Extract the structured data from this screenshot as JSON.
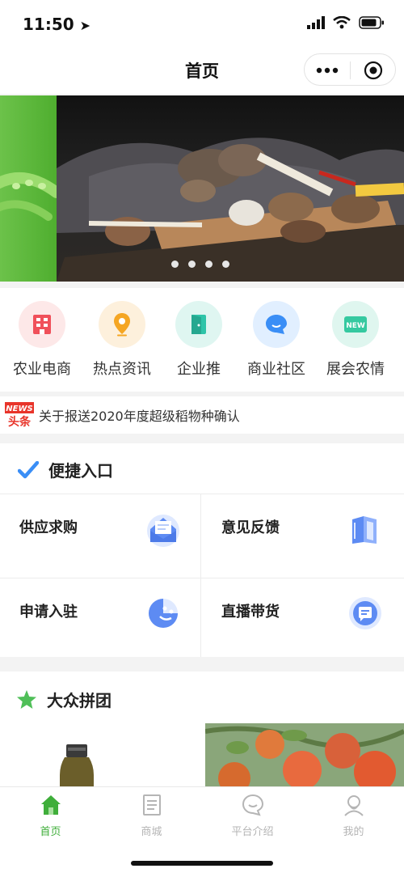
{
  "status": {
    "time": "11:50"
  },
  "nav": {
    "title": "首页"
  },
  "banner": {
    "slide_count": 4,
    "active_slide": 1
  },
  "categories": [
    {
      "label": "农业电商",
      "icon": "shop-building-icon",
      "bg": "#fde8e8",
      "fg": "#f0505a"
    },
    {
      "label": "热点资讯",
      "icon": "location-pin-icon",
      "bg": "#fdf0dc",
      "fg": "#f5a623"
    },
    {
      "label": "企业推",
      "icon": "door-icon",
      "bg": "#dff6f1",
      "fg": "#2ec4a8"
    },
    {
      "label": "商业社区",
      "icon": "chat-bubble-icon",
      "bg": "#e1efff",
      "fg": "#3a8ef6"
    },
    {
      "label": "展会农情",
      "icon": "new-badge-icon",
      "bg": "#dff6ef",
      "fg": "#35c9a0"
    }
  ],
  "news": {
    "badge_top": "NEWS",
    "badge_bottom": "头条",
    "text": "关于报送2020年度超级稻物种确认"
  },
  "quick_entry": {
    "title": "便捷入口",
    "items": [
      {
        "label": "供应求购",
        "icon": "envelope-icon"
      },
      {
        "label": "意见反馈",
        "icon": "book-icon"
      },
      {
        "label": "申请入驻",
        "icon": "smile-face-icon"
      },
      {
        "label": "直播带货",
        "icon": "message-icon"
      }
    ]
  },
  "group_buy": {
    "title": "大众拼团"
  },
  "tabbar": {
    "active_color": "#3fae3a",
    "inactive_color": "#b5b5b5",
    "items": [
      {
        "label": "首页",
        "icon": "home-icon",
        "active": true
      },
      {
        "label": "商城",
        "icon": "document-icon",
        "active": false
      },
      {
        "label": "平台介绍",
        "icon": "chat-icon",
        "active": false
      },
      {
        "label": "我的",
        "icon": "user-icon",
        "active": false
      }
    ]
  }
}
